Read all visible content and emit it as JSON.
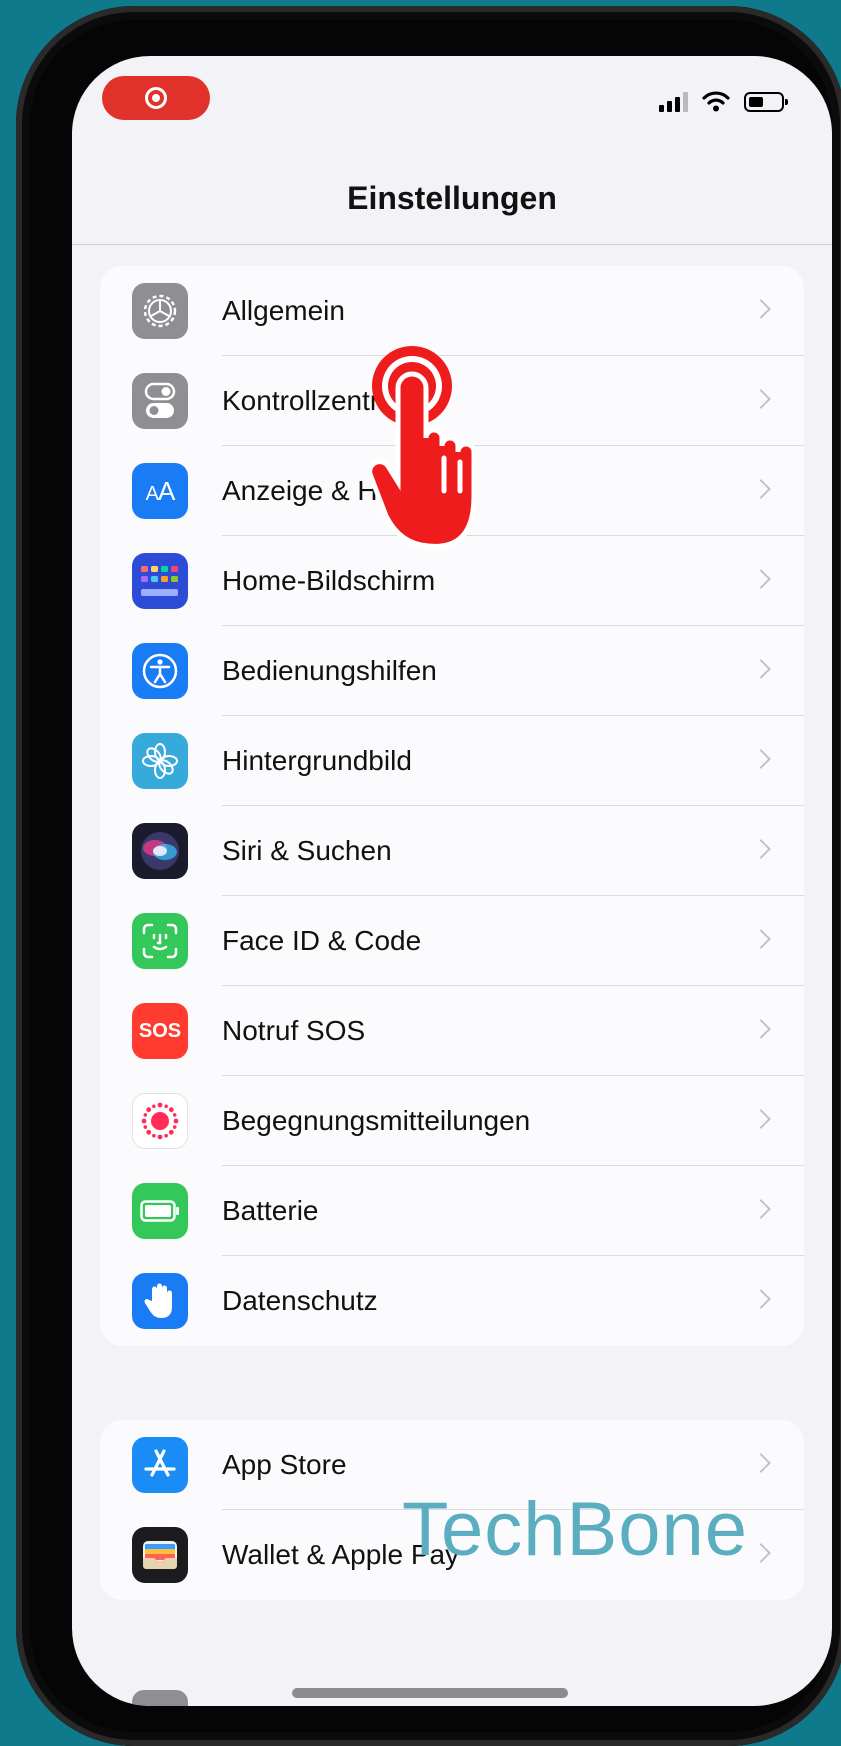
{
  "nav": {
    "title": "Einstellungen"
  },
  "groups": [
    {
      "items": [
        {
          "label": "Allgemein",
          "icon": "gear-icon",
          "color": "#8e8e93"
        },
        {
          "label": "Kontrollzentrum",
          "icon": "toggles-icon",
          "color": "#8e8e93"
        },
        {
          "label": "Anzeige & Helligkeit",
          "icon": "text-size-icon",
          "color": "#1a7cf5"
        },
        {
          "label": "Home-Bildschirm",
          "icon": "app-grid-icon",
          "color": "#2d4bd6"
        },
        {
          "label": "Bedienungshilfen",
          "icon": "accessibility-icon",
          "color": "#1a7cf5"
        },
        {
          "label": "Hintergrundbild",
          "icon": "flower-icon",
          "color": "#37aadc"
        },
        {
          "label": "Siri & Suchen",
          "icon": "siri-icon",
          "color": "#1b1b2e"
        },
        {
          "label": "Face ID & Code",
          "icon": "face-id-icon",
          "color": "#34c759"
        },
        {
          "label": "Notruf SOS",
          "icon": "sos-icon",
          "color": "#ff3b30",
          "icon_text": "SOS"
        },
        {
          "label": "Begegnungsmitteilungen",
          "icon": "exposure-icon",
          "color": "#ffffff"
        },
        {
          "label": "Batterie",
          "icon": "battery-icon",
          "color": "#34c759"
        },
        {
          "label": "Datenschutz",
          "icon": "hand-icon",
          "color": "#1a7cf5"
        }
      ]
    },
    {
      "items": [
        {
          "label": "App Store",
          "icon": "app-store-icon",
          "color": "#1a8cf5"
        },
        {
          "label": "Wallet & Apple Pay",
          "icon": "wallet-icon",
          "color": "#1c1c1e"
        }
      ]
    }
  ],
  "watermark": "TechBone",
  "colors": {
    "background": "#0e7a8c",
    "recording": "#e0322a",
    "tap_hand": "#ee1c1c",
    "chevron": "#c2c2c8"
  }
}
